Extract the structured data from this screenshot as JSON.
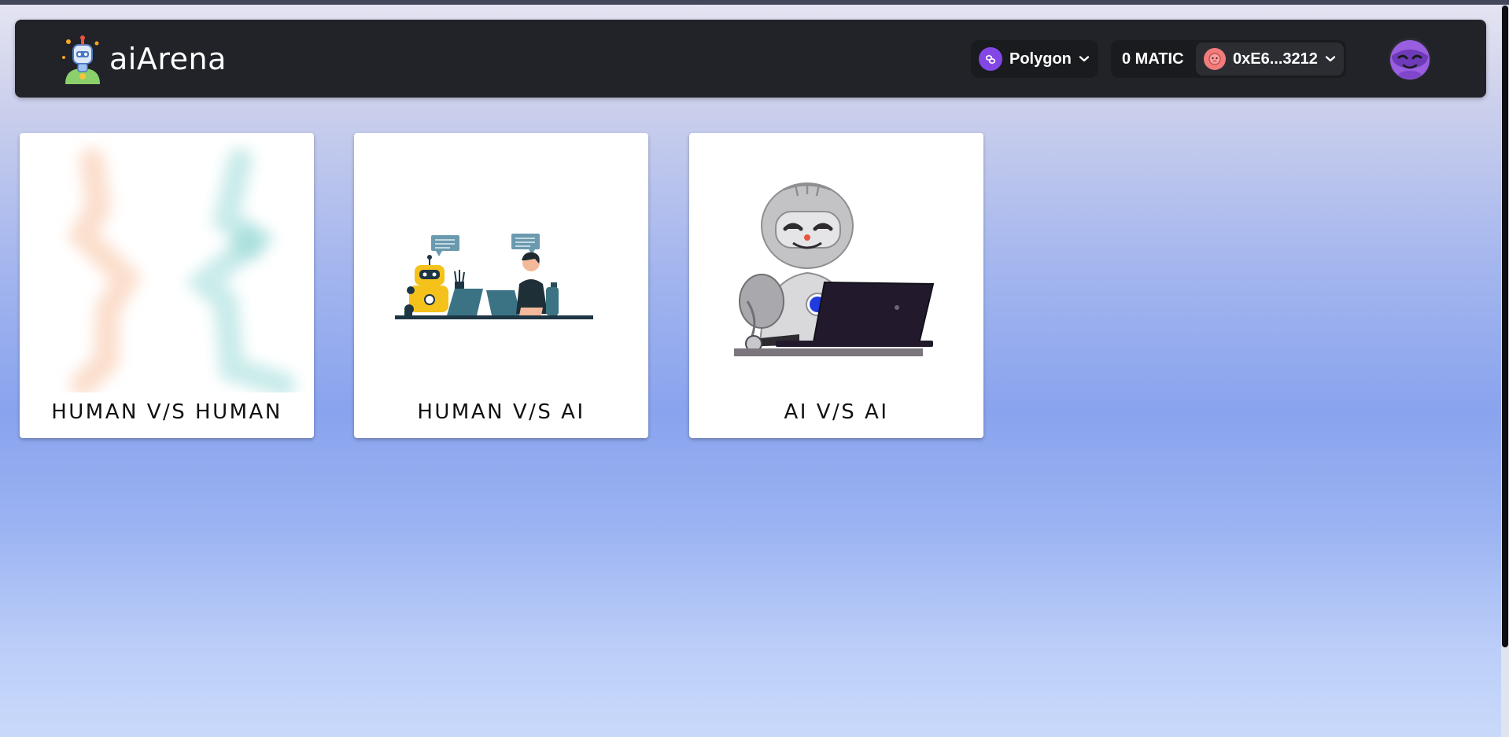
{
  "app": {
    "brand_name": "aiArena",
    "brand_logo_icon": "robot-logo-icon"
  },
  "navbar": {
    "chain": {
      "label": "Polygon",
      "icon": "polygon-chain-icon"
    },
    "balance": "0 MATIC",
    "account": {
      "address": "0xE6...3212",
      "icon": "account-avatar-icon"
    },
    "profile_icon": "profile-avatar-icon"
  },
  "cards": [
    {
      "title": "HUMAN V/S HUMAN",
      "image": "human-vs-human-illustration"
    },
    {
      "title": "HUMAN V/S AI",
      "image": "human-vs-ai-illustration"
    },
    {
      "title": "AI V/S AI",
      "image": "ai-vs-ai-illustration"
    }
  ],
  "colors": {
    "navbar_bg": "#212328",
    "polygon_purple": "#8247e5",
    "card_bg": "#ffffff"
  }
}
